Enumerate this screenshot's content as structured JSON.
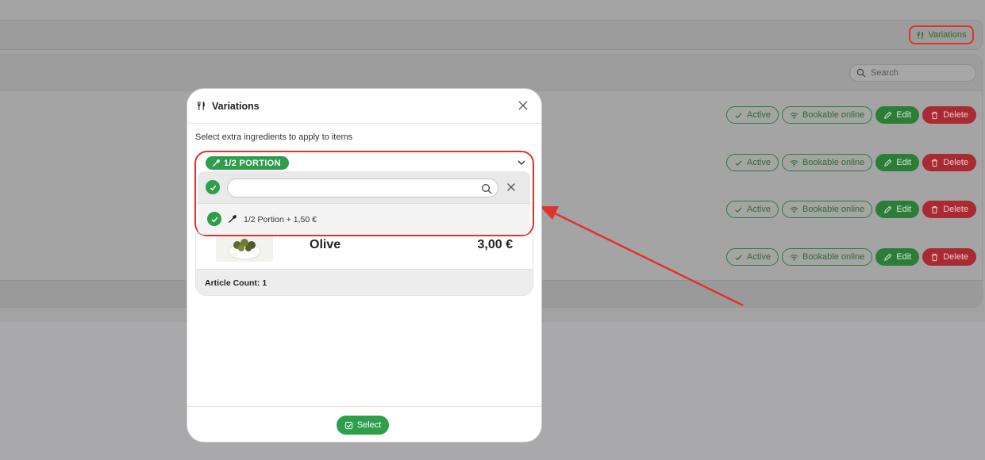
{
  "background": {
    "toolbar": {
      "variations_label": "Variations"
    },
    "search": {
      "placeholder": "Search"
    },
    "row_actions": {
      "active": "Active",
      "bookable": "Bookable online",
      "edit": "Edit",
      "delete": "Delete"
    }
  },
  "modal": {
    "title": "Variations",
    "instruction": "Select extra ingredients to apply to items",
    "selected_tag": "1/2 PORTION",
    "search_value": "",
    "options": [
      {
        "label": "1/2 Portion + 1,50 €"
      }
    ],
    "article": {
      "name": "Olive",
      "price": "3,00 €"
    },
    "article_count": "Article Count: 1",
    "select_button": "Select"
  },
  "colors": {
    "primary_green": "#2e9e4b",
    "danger_red": "#a82a33",
    "highlight_red": "#e0342a"
  }
}
